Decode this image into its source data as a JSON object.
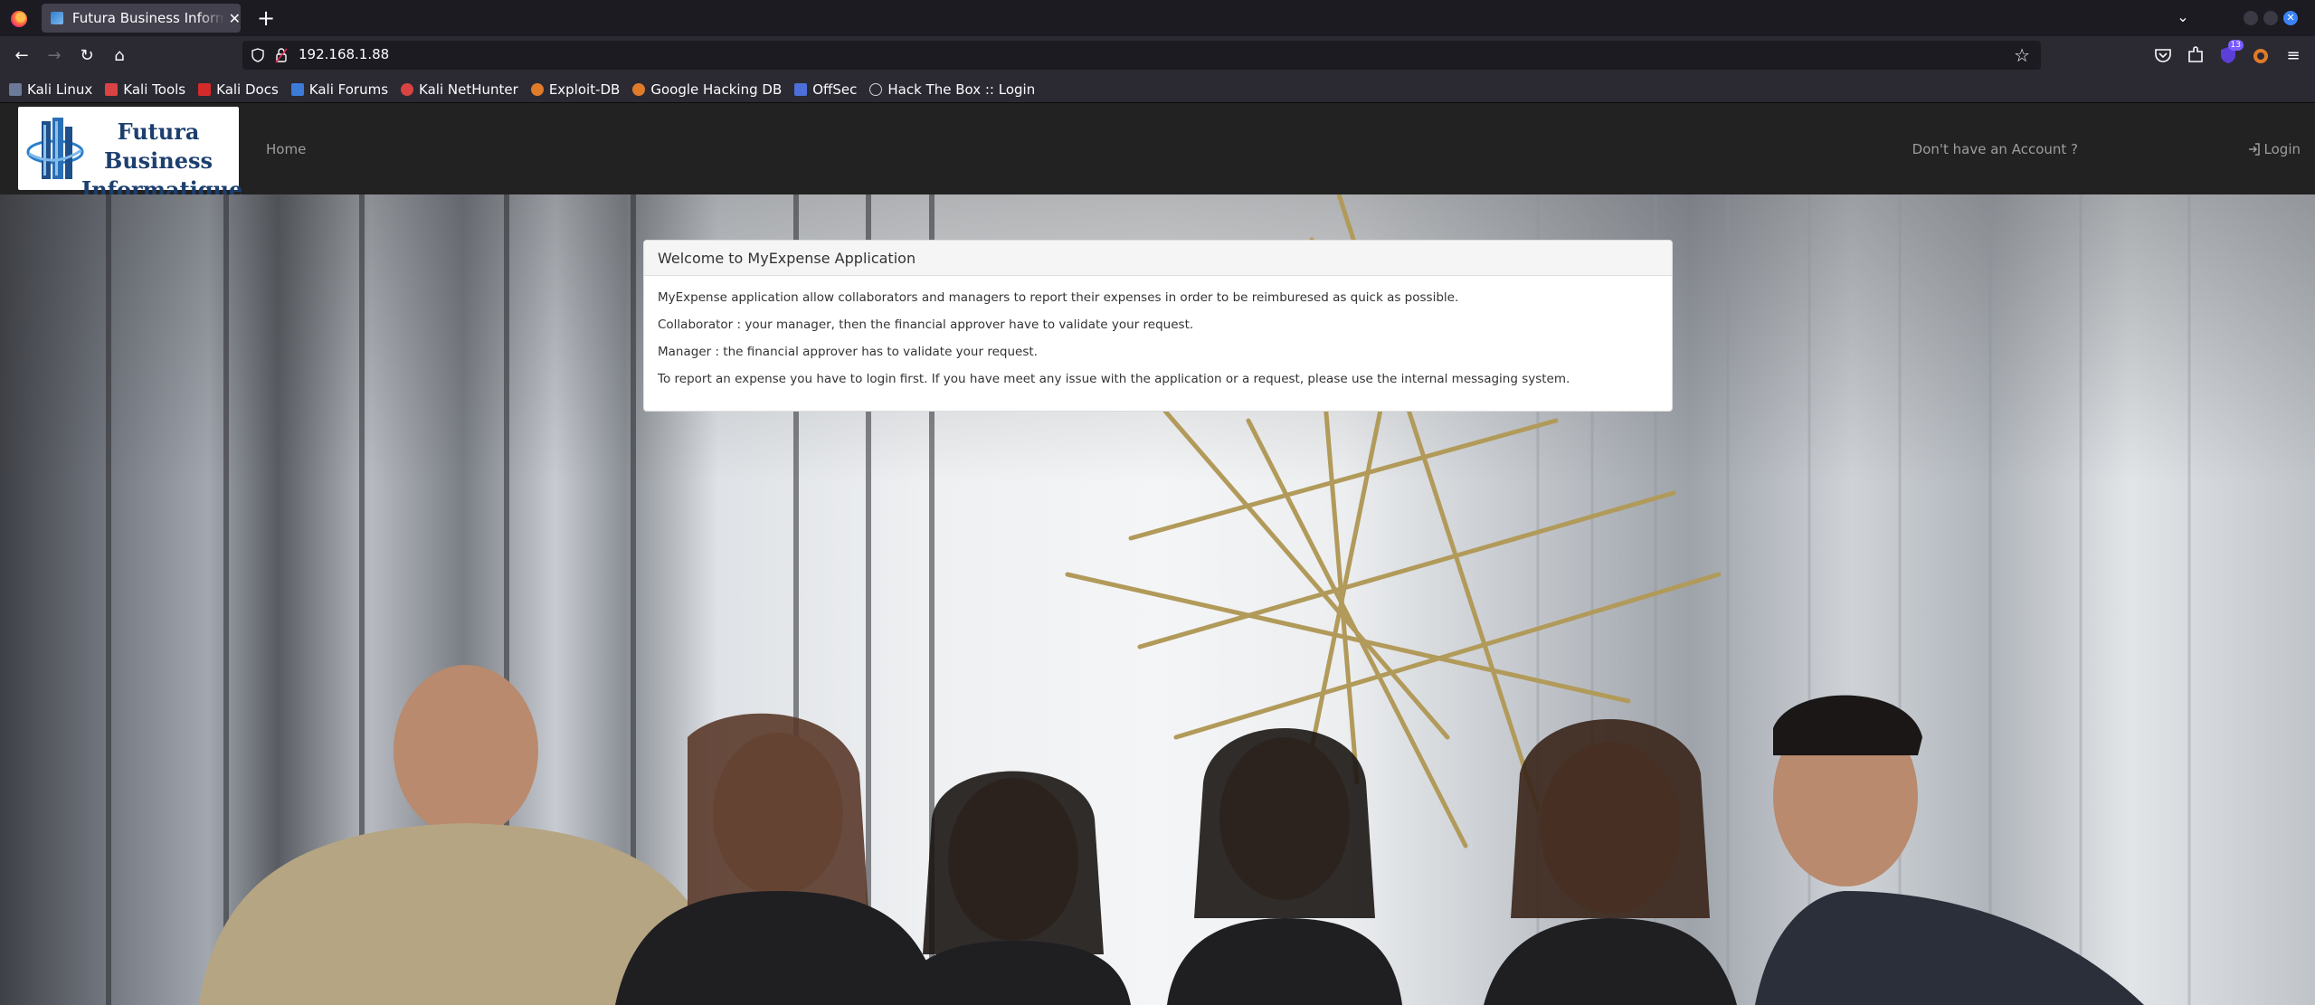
{
  "browser": {
    "tab_title": "Futura Business Informatique",
    "url": "192.168.1.88",
    "bookmarks": [
      {
        "label": "Kali Linux",
        "color": "#6b7a99"
      },
      {
        "label": "Kali Tools",
        "color": "#d94343"
      },
      {
        "label": "Kali Docs",
        "color": "#d52a2a"
      },
      {
        "label": "Kali Forums",
        "color": "#3d7bd9"
      },
      {
        "label": "Kali NetHunter",
        "color": "#d94343"
      },
      {
        "label": "Exploit-DB",
        "color": "#e07b2a"
      },
      {
        "label": "Google Hacking DB",
        "color": "#e07b2a"
      },
      {
        "label": "OffSec",
        "color": "#4d6fd9"
      },
      {
        "label": "Hack The Box :: Login",
        "color": "#cfd0d4"
      }
    ],
    "extensions_badge": "13"
  },
  "site": {
    "logo_line1": "Futura Business",
    "logo_line2": "Informatique",
    "nav_home": "Home",
    "nav_register": "Don't have an Account ?",
    "nav_login": "Login"
  },
  "welcome": {
    "title": "Welcome to MyExpense Application",
    "paragraphs": [
      "MyExpense application allow collaborators and managers to report their expenses in order to be reimburesed as quick as possible.",
      "Collaborator : your manager, then the financial approver have to validate your request.",
      "Manager : the financial approver has to validate your request.",
      "To report an expense you have to login first. If you have meet any issue with the application or a request, please use the internal messaging system."
    ]
  },
  "colors": {
    "chrome_bg": "#1c1b22",
    "toolbar_bg": "#2b2a33",
    "site_header_bg": "#222222",
    "nav_link": "#9d9d9d",
    "logo_blue": "#1d3f6f"
  }
}
